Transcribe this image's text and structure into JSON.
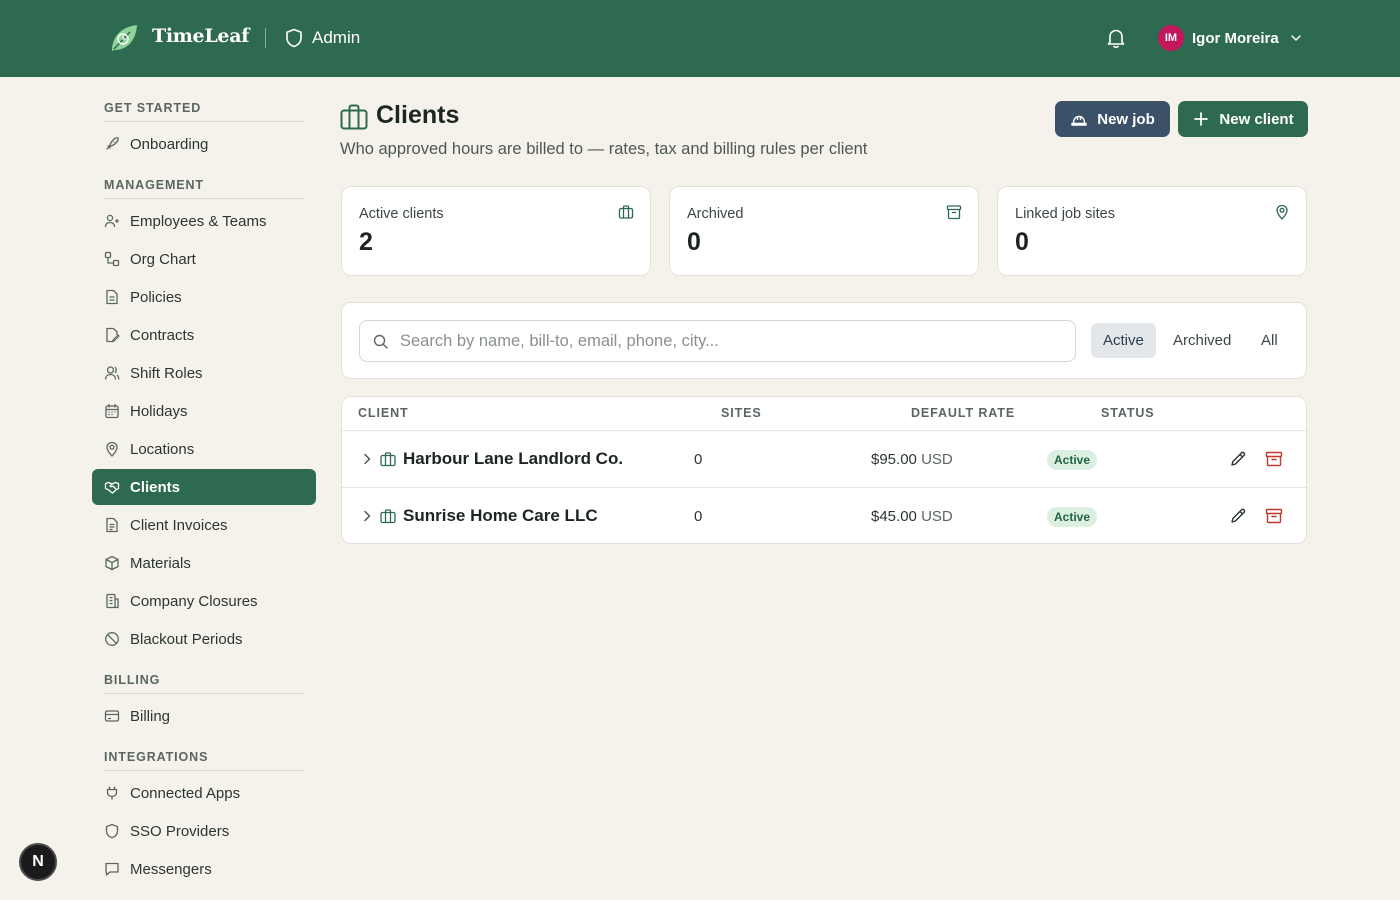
{
  "topbar": {
    "brand": "TimeLeaf",
    "section": "Admin",
    "user": {
      "initials": "IM",
      "name": "Igor Moreira"
    },
    "colors": {
      "bar": "#2e6a50",
      "avatar": "#c2185b"
    }
  },
  "sidebar": {
    "sections": [
      {
        "title": "GET STARTED",
        "items": [
          {
            "label": "Onboarding",
            "icon": "rocket-icon"
          }
        ]
      },
      {
        "title": "MANAGEMENT",
        "items": [
          {
            "label": "Employees & Teams",
            "icon": "users-icon"
          },
          {
            "label": "Org Chart",
            "icon": "org-chart-icon"
          },
          {
            "label": "Policies",
            "icon": "document-icon"
          },
          {
            "label": "Contracts",
            "icon": "contract-icon"
          },
          {
            "label": "Shift Roles",
            "icon": "user-roles-icon"
          },
          {
            "label": "Holidays",
            "icon": "calendar-icon"
          },
          {
            "label": "Locations",
            "icon": "map-pin-icon"
          },
          {
            "label": "Clients",
            "icon": "handshake-icon",
            "active": true
          },
          {
            "label": "Client Invoices",
            "icon": "invoice-icon"
          },
          {
            "label": "Materials",
            "icon": "box-icon"
          },
          {
            "label": "Company Closures",
            "icon": "building-icon"
          },
          {
            "label": "Blackout Periods",
            "icon": "ban-icon"
          }
        ]
      },
      {
        "title": "BILLING",
        "items": [
          {
            "label": "Billing",
            "icon": "credit-card-icon"
          }
        ]
      },
      {
        "title": "INTEGRATIONS",
        "items": [
          {
            "label": "Connected Apps",
            "icon": "plug-icon"
          },
          {
            "label": "SSO Providers",
            "icon": "shield-icon"
          },
          {
            "label": "Messengers",
            "icon": "message-icon"
          }
        ]
      }
    ]
  },
  "page": {
    "title": "Clients",
    "subtitle": "Who approved hours are billed to — rates, tax and billing rules per client",
    "new_job_label": "New job",
    "new_client_label": "New client"
  },
  "stats": [
    {
      "label": "Active clients",
      "value": "2",
      "icon": "briefcase-icon"
    },
    {
      "label": "Archived",
      "value": "0",
      "icon": "archive-icon"
    },
    {
      "label": "Linked job sites",
      "value": "0",
      "icon": "map-pin-icon"
    }
  ],
  "filters": {
    "search_placeholder": "Search by name, bill-to, email, phone, city...",
    "search_value": "",
    "tabs": [
      "Active",
      "Archived",
      "All"
    ],
    "selected_tab": "Active"
  },
  "table": {
    "headers": {
      "client": "CLIENT",
      "sites": "SITES",
      "rate": "DEFAULT RATE",
      "status": "STATUS"
    },
    "rows": [
      {
        "name": "Harbour Lane Landlord Co.",
        "sites": "0",
        "rate": "$95.00",
        "currency": "USD",
        "status": "Active"
      },
      {
        "name": "Sunrise Home Care LLC",
        "sites": "0",
        "rate": "$45.00",
        "currency": "USD",
        "status": "Active"
      }
    ]
  },
  "fab": {
    "label": "N"
  }
}
